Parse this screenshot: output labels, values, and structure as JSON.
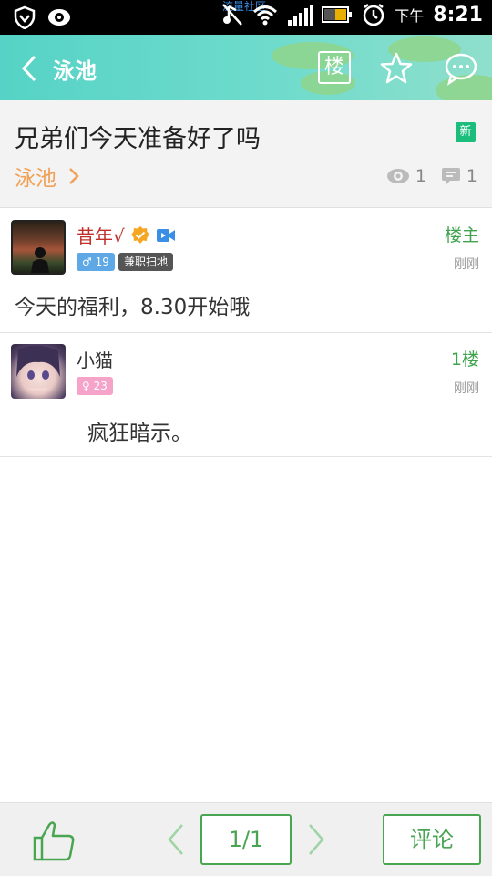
{
  "status_bar": {
    "carrier_text": "流量社区",
    "ampm": "下午",
    "time": "8:21"
  },
  "header": {
    "title": "泳池",
    "icons": [
      "back-arrow-icon",
      "floor-icon",
      "star-icon",
      "chat-bubble-icon"
    ],
    "floor_icon_label": "楼"
  },
  "post_header": {
    "title": "兄弟们今天准备好了吗",
    "new_badge": "新",
    "forum_link": "泳池",
    "views": "1",
    "comments": "1"
  },
  "posts": [
    {
      "username": "昔年√",
      "username_color": "#c0312b",
      "gender_tag": "♂ 19",
      "role_tag": "兼职扫地",
      "floor": "楼主",
      "time": "刚刚",
      "content": "今天的福利，8.30开始哦"
    },
    {
      "username": "小猫",
      "username_color": "#333333",
      "gender_tag": "♀ 23",
      "floor": "1楼",
      "time": "刚刚",
      "content": "疯狂暗示。"
    }
  ],
  "bottom_bar": {
    "page": "1/1",
    "comment_label": "评论"
  },
  "colors": {
    "accent_green": "#4aa552",
    "forum_orange": "#f0a156",
    "header_teal": "#5fd6c8"
  }
}
